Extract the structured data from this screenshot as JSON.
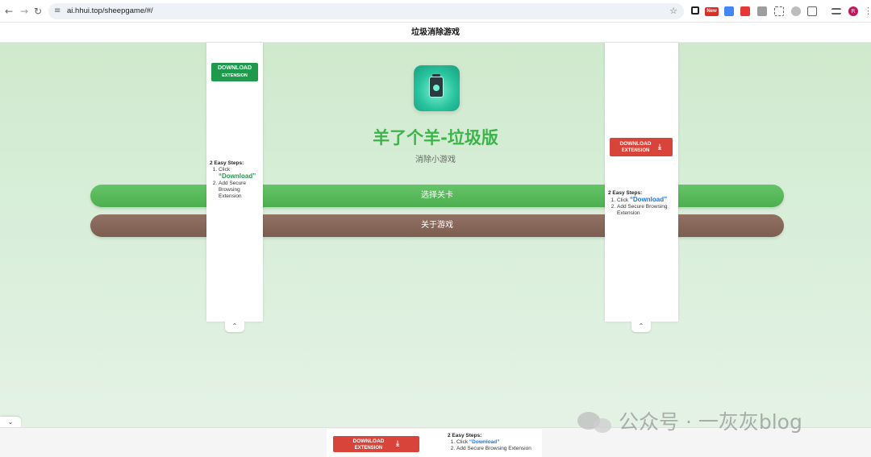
{
  "browser": {
    "url": "ai.hhui.top/sheepgame/#/",
    "new_badge": "New",
    "avatar_letter": "R"
  },
  "page": {
    "header_title": "垃圾消除游戏"
  },
  "game": {
    "title": "羊了个羊-垃圾版",
    "subtitle": "消除小游戏",
    "select_level_label": "选择关卡",
    "about_label": "关于游戏"
  },
  "ads": {
    "download_line1": "DOWNLOAD",
    "download_line2": "EXTENSION",
    "steps_title": "2 Easy Steps:",
    "step1_prefix": "Click",
    "step1_highlight": "“Download”",
    "step2": "Add Secure Browsing Extension"
  },
  "watermark": {
    "text": "公众号 · 一灰灰blog"
  },
  "colors": {
    "accent_green": "#3bb54a",
    "button_green": "#4caf50",
    "button_brown": "#7d5d50",
    "download_red": "#d9443a",
    "download_green": "#1f9a4d",
    "link_blue": "#1a73e8"
  },
  "icons": {
    "back": "arrow-left-icon",
    "forward": "arrow-right-icon",
    "reload": "reload-icon",
    "site_info": "tune-icon",
    "bookmark": "star-icon",
    "menu": "kebab-menu-icon",
    "collapse": "chevron-up-icon",
    "expand": "chevron-down-icon",
    "download": "download-icon",
    "app": "trash-bin-icon"
  }
}
